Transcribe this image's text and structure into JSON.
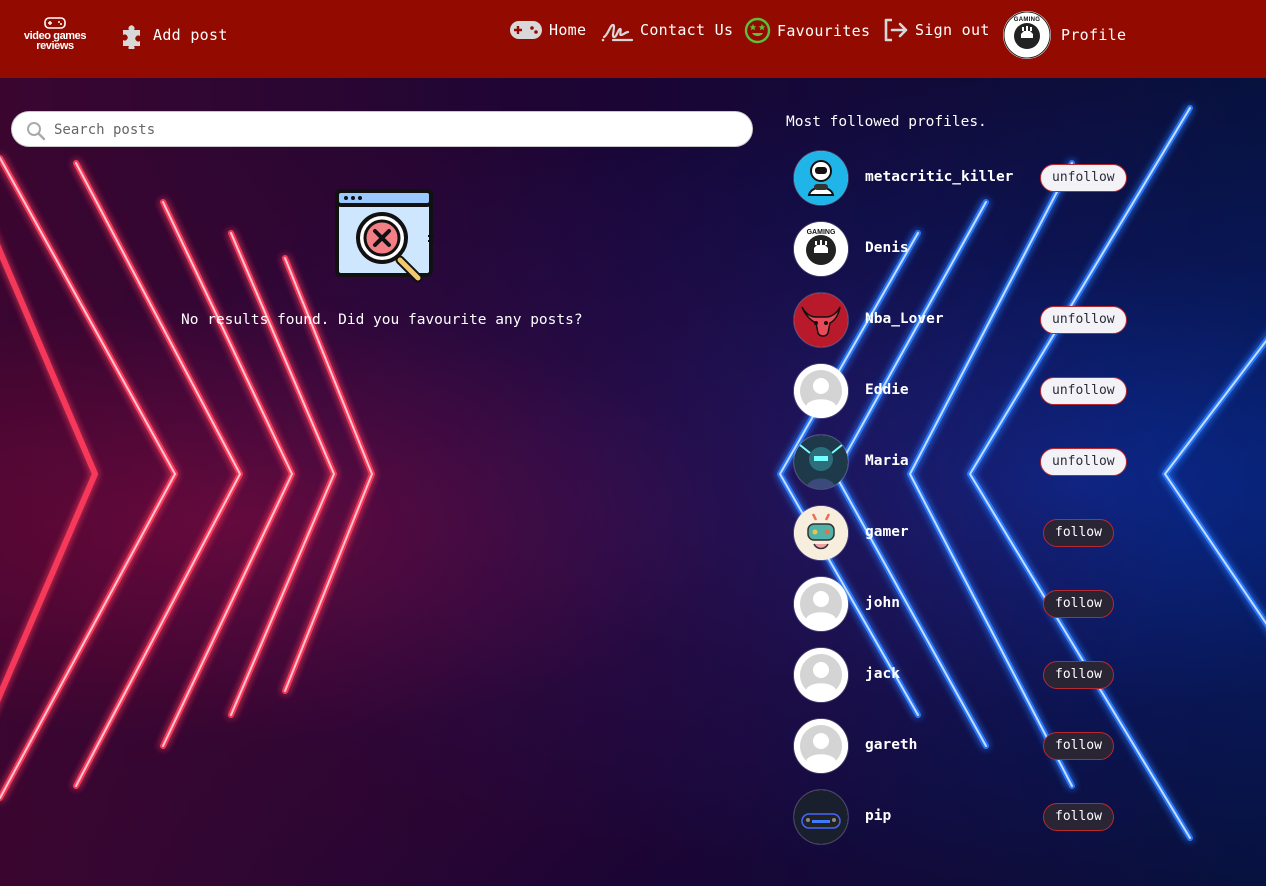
{
  "nav": {
    "logo_line1": "video games",
    "logo_line2": "reviews",
    "add_post": "Add post",
    "home": "Home",
    "contact": "Contact Us",
    "favourites": "Favourites",
    "sign_out": "Sign out",
    "profile": "Profile",
    "avatar_caption": "GAMING"
  },
  "search": {
    "placeholder": "Search posts",
    "value": ""
  },
  "empty_state": {
    "message": "No results found. Did you favourite any posts?"
  },
  "sidebar": {
    "title": "Most followed profiles.",
    "profiles": [
      {
        "name": "metacritic_killer",
        "button": "unfollow",
        "avatar": "astronaut-gamer"
      },
      {
        "name": "Denis",
        "button": "",
        "avatar": "gaming-badge"
      },
      {
        "name": "Nba_Lover",
        "button": "unfollow",
        "avatar": "bulls-logo"
      },
      {
        "name": "Eddie",
        "button": "unfollow",
        "avatar": "default-user"
      },
      {
        "name": "Maria",
        "button": "unfollow",
        "avatar": "cyber-character"
      },
      {
        "name": "gamer",
        "button": "follow",
        "avatar": "cartoon-controller"
      },
      {
        "name": "john",
        "button": "follow",
        "avatar": "default-user"
      },
      {
        "name": "jack",
        "button": "follow",
        "avatar": "default-user"
      },
      {
        "name": "gareth",
        "button": "follow",
        "avatar": "default-user"
      },
      {
        "name": "pip",
        "button": "follow",
        "avatar": "controller-photo"
      }
    ]
  },
  "colors": {
    "nav_bg": "#930b00",
    "button_border": "#b8292f",
    "follow_bg": "#2a2535",
    "unfollow_bg": "#f3f3f7"
  }
}
